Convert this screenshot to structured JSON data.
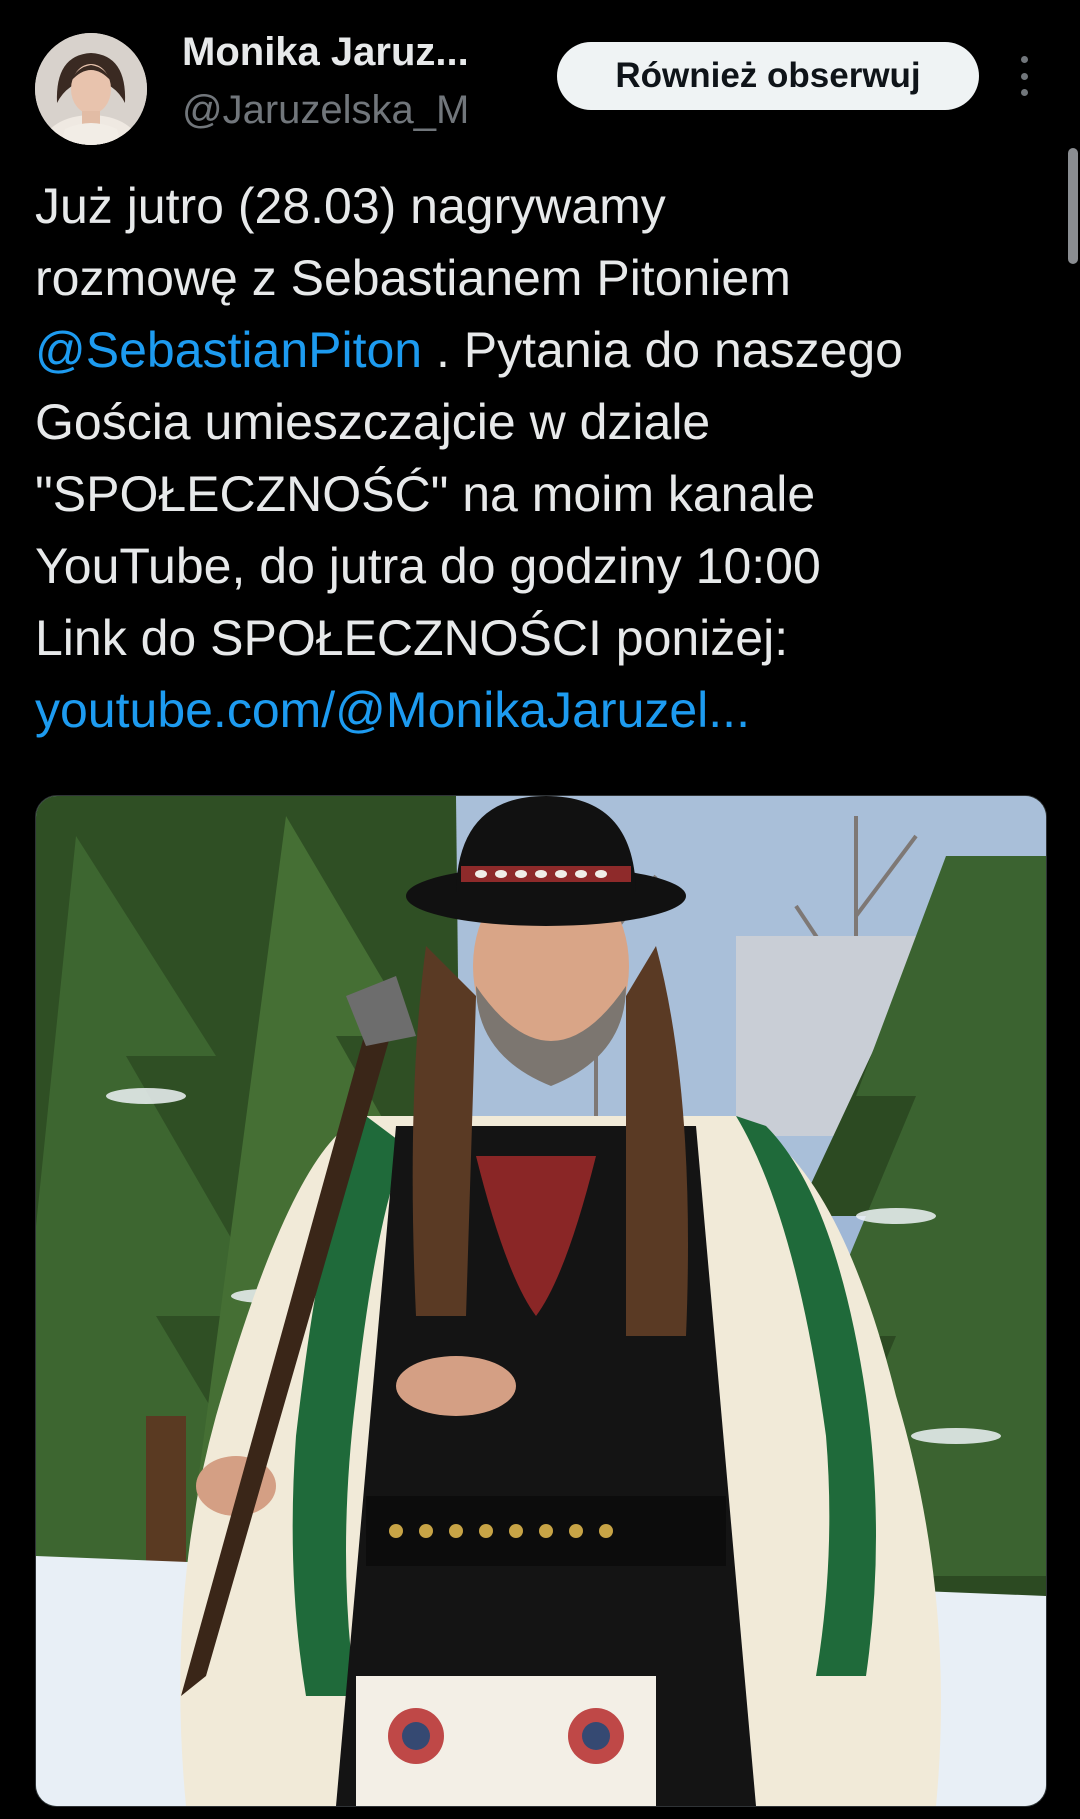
{
  "author": {
    "display_name": "Monika Jaruz...",
    "handle": "@Jaruzelska_M"
  },
  "header": {
    "follow_label": "Również obserwuj",
    "more_icon": "more-vertical-icon"
  },
  "tweet": {
    "line1": "Już jutro (28.03) nagrywamy",
    "line2": "rozmowę z Sebastianem Pitoniem",
    "mention": "@SebastianPiton",
    "line3_rest": " . Pytania do naszego",
    "line4": "Gościa umieszczajcie w dziale",
    "line5": "\"SPOŁECZNOŚĆ\" na moim kanale",
    "line6": "YouTube, do jutra do godziny 10:00",
    "line7": "Link do SPOŁECZNOŚCI poniżej:",
    "url": "youtube.com/@MonikaJaruzel..."
  },
  "colors": {
    "background": "#000000",
    "text": "#e7e9ea",
    "secondary": "#71767b",
    "link": "#1d9bf0",
    "button_bg": "#eff3f4"
  }
}
